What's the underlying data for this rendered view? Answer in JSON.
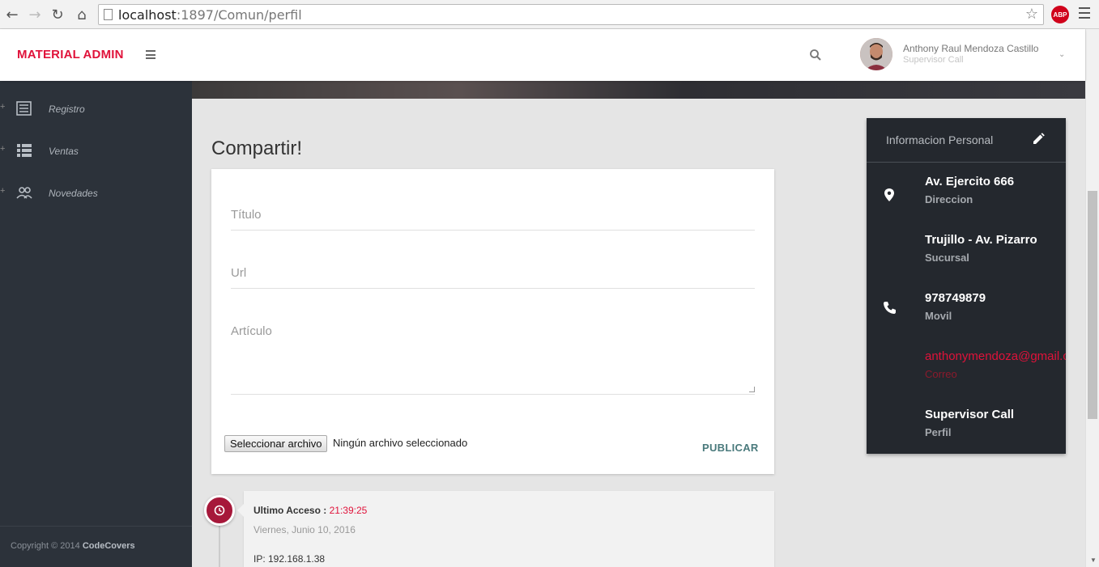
{
  "browser": {
    "url_host": "localhost",
    "url_rest": ":1897/Comun/perfil",
    "adblock_label": "ABP"
  },
  "header": {
    "logo": "MATERIAL ADMIN",
    "user_name": "Anthony Raul Mendoza Castillo",
    "user_role": "Supervisor Call"
  },
  "sidebar": {
    "items": [
      {
        "label": "Registro",
        "icon": "list-icon"
      },
      {
        "label": "Ventas",
        "icon": "grid-list-icon"
      },
      {
        "label": "Novedades",
        "icon": "group-icon"
      }
    ],
    "copyright_prefix": "Copyright © 2014",
    "copyright_brand": "CodeCovers"
  },
  "share": {
    "title": "Compartir!",
    "field_title_placeholder": "Título",
    "field_url_placeholder": "Url",
    "field_article_placeholder": "Artículo",
    "file_button": "Seleccionar archivo",
    "file_status": "Ningún archivo seleccionado",
    "publish": "PUBLICAR"
  },
  "timeline": {
    "label": "Ultimo Acceso :",
    "time": "21:39:25",
    "date": "Viernes, Junio 10, 2016",
    "ip": "IP: 192.168.1.38"
  },
  "info": {
    "title": "Informacion Personal",
    "rows": [
      {
        "value": "Av. Ejercito 666",
        "sub": "Direccion",
        "icon": "location-pin-icon"
      },
      {
        "value": "Trujillo - Av. Pizarro",
        "sub": "Sucursal",
        "icon": ""
      },
      {
        "value": "978749879",
        "sub": "Movil",
        "icon": "phone-icon"
      },
      {
        "value": "anthonymendoza@gmail.com",
        "sub": "Correo",
        "icon": ""
      },
      {
        "value": "Supervisor Call",
        "sub": "Perfil",
        "icon": ""
      }
    ]
  },
  "colors": {
    "brand": "#e0123a",
    "sidebar": "#2c323a",
    "info_card": "#24282e",
    "timeline_dot": "#a6183a",
    "publish": "#4a7a7c"
  }
}
